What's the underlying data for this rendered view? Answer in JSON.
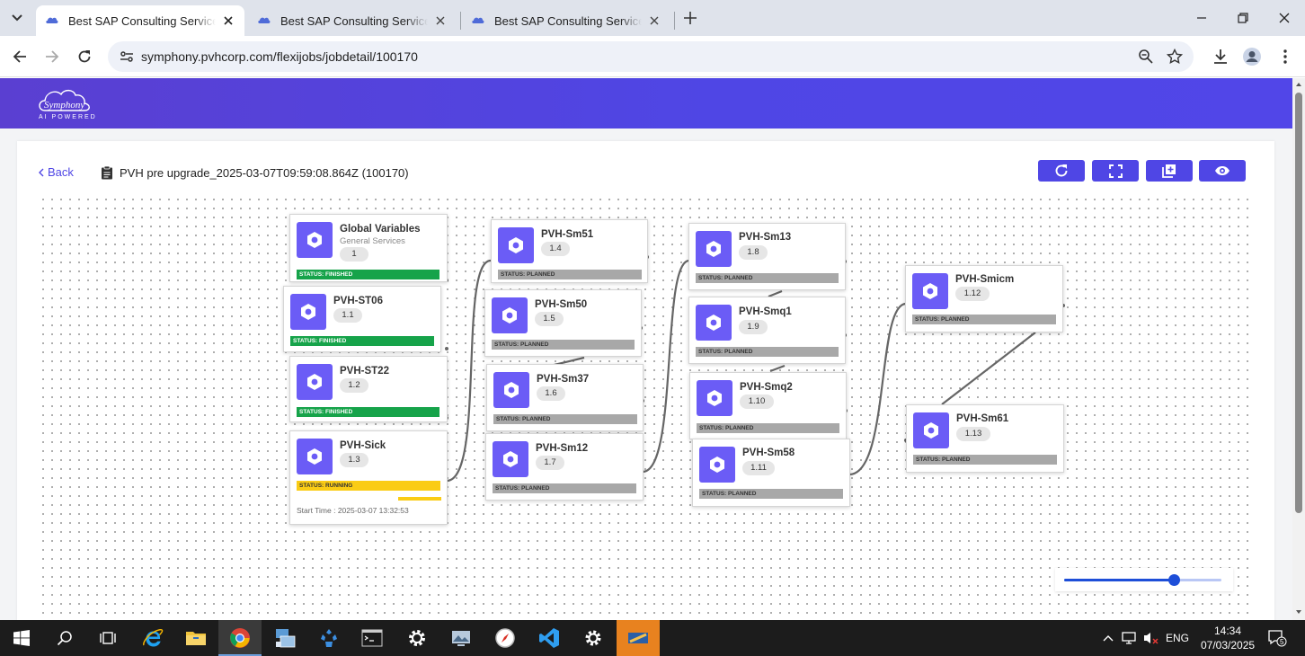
{
  "browser": {
    "tabs": [
      {
        "title": "Best SAP Consulting Services ar",
        "active": true
      },
      {
        "title": "Best SAP Consulting Services ar",
        "active": false
      },
      {
        "title": "Best SAP Consulting Services ar",
        "active": false
      }
    ],
    "url": "symphony.pvhcorp.com/flexijobs/jobdetail/100170"
  },
  "app": {
    "logo_text": "Symphony",
    "logo_sub": "AI POWERED",
    "back_label": "Back",
    "job_title": "PVH pre upgrade_2025-03-07T09:59:08.864Z (100170)",
    "accent": "#4f46e5"
  },
  "nodes": [
    {
      "name": "Global Variables",
      "sub": "General Services",
      "version": "1",
      "status": "STATUS: FINISHED"
    },
    {
      "name": "PVH-ST06",
      "version": "1.1",
      "status": "STATUS: FINISHED"
    },
    {
      "name": "PVH-ST22",
      "version": "1.2",
      "status": "STATUS: FINISHED"
    },
    {
      "name": "PVH-Sick",
      "version": "1.3",
      "status": "STATUS: RUNNING",
      "start_time": "Start Time : 2025-03-07 13:32:53"
    },
    {
      "name": "PVH-Sm51",
      "version": "1.4",
      "status": "STATUS: PLANNED"
    },
    {
      "name": "PVH-Sm50",
      "version": "1.5",
      "status": "STATUS: PLANNED"
    },
    {
      "name": "PVH-Sm37",
      "version": "1.6",
      "status": "STATUS: PLANNED"
    },
    {
      "name": "PVH-Sm12",
      "version": "1.7",
      "status": "STATUS: PLANNED"
    },
    {
      "name": "PVH-Sm13",
      "version": "1.8",
      "status": "STATUS: PLANNED"
    },
    {
      "name": "PVH-Smq1",
      "version": "1.9",
      "status": "STATUS: PLANNED"
    },
    {
      "name": "PVH-Smq2",
      "version": "1.10",
      "status": "STATUS: PLANNED"
    },
    {
      "name": "PVH-Sm58",
      "version": "1.11",
      "status": "STATUS: PLANNED"
    },
    {
      "name": "PVH-Smicm",
      "version": "1.12",
      "status": "STATUS: PLANNED"
    },
    {
      "name": "PVH-Sm61",
      "version": "1.13",
      "status": "STATUS: PLANNED"
    }
  ],
  "zoom_level": 0.7,
  "taskbar": {
    "lang": "ENG",
    "time": "14:34",
    "date": "07/03/2025",
    "notifications": "5"
  }
}
